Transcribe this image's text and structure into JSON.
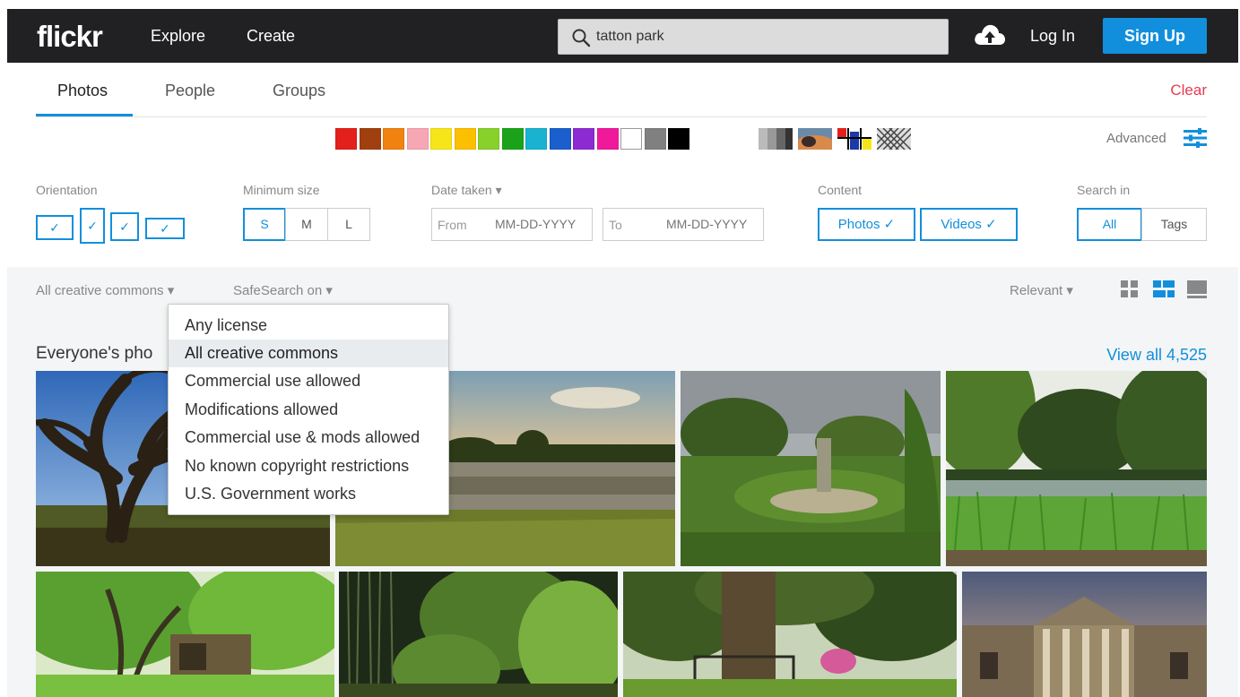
{
  "header": {
    "logo": "flickr",
    "explore": "Explore",
    "create": "Create",
    "search_value": "tatton park",
    "login": "Log In",
    "signup": "Sign Up"
  },
  "tabs": [
    {
      "label": "Photos",
      "active": true
    },
    {
      "label": "People",
      "active": false
    },
    {
      "label": "Groups",
      "active": false
    }
  ],
  "clear_label": "Clear",
  "colors": [
    "#e3201b",
    "#a0400e",
    "#f0820f",
    "#f7a6b4",
    "#f6e619",
    "#fcc000",
    "#87d12a",
    "#1aa31a",
    "#19b2d1",
    "#1a5fcd",
    "#8b2bd1",
    "#f0199b",
    "#ffffff",
    "#808080",
    "#000000"
  ],
  "advanced_label": "Advanced",
  "filters": {
    "orientation_label": "Orientation",
    "min_size_label": "Minimum size",
    "sizes": [
      "S",
      "M",
      "L"
    ],
    "selected_size": "S",
    "date_label": "Date taken",
    "from_label": "From",
    "to_label": "To",
    "date_placeholder": "MM-DD-YYYY",
    "content_label": "Content",
    "content_photos": "Photos",
    "content_videos": "Videos",
    "search_in_label": "Search in",
    "search_in_all": "All",
    "search_in_tags": "Tags"
  },
  "toolbar": {
    "license": "All creative commons",
    "safesearch": "SafeSearch on",
    "sort": "Relevant"
  },
  "section_title": "Everyone's pho",
  "view_all": "View all 4,525",
  "license_menu": {
    "items": [
      "Any license",
      "All creative commons",
      "Commercial use allowed",
      "Modifications allowed",
      "Commercial use & mods allowed",
      "No known copyright restrictions",
      "U.S. Government works"
    ],
    "selected": "All creative commons"
  },
  "icons": {
    "search": "search-icon",
    "upload": "cloud-upload-icon",
    "advanced": "sliders-icon",
    "check": "check-icon",
    "caret": "caret-down-icon"
  }
}
